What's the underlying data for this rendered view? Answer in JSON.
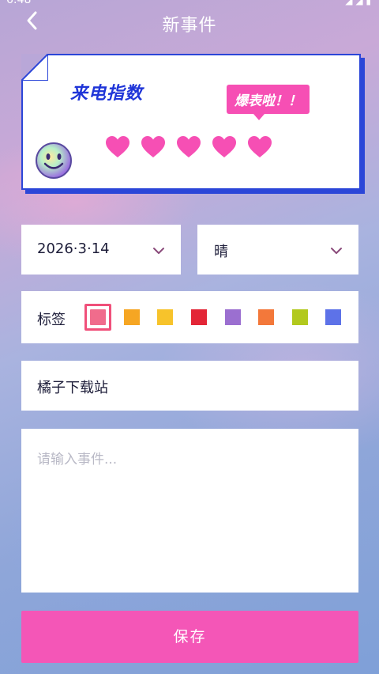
{
  "status_bar": {
    "time": "6:48",
    "icons": "◢ ◢ ▮"
  },
  "header": {
    "title": "新事件",
    "back_icon": "chevron-left-icon"
  },
  "card": {
    "title": "来电指数",
    "badge": "爆表啦！！",
    "hearts_filled": 5,
    "hearts_total": 5,
    "heart_color": "#f64fb4",
    "accent_color": "#2b46d8"
  },
  "form": {
    "date": {
      "value": "2026·3·14"
    },
    "weather": {
      "value": "晴"
    },
    "tags": {
      "label": "标签",
      "selected_index": 0,
      "colors": [
        "#f06c8c",
        "#f6a623",
        "#f7c32b",
        "#e32637",
        "#9b6fd0",
        "#f3783a",
        "#b2c91e",
        "#5d72e8"
      ]
    },
    "name": {
      "value": "橘子下载站"
    },
    "content": {
      "placeholder": "请输入事件..."
    }
  },
  "actions": {
    "save_label": "保存",
    "save_color": "#f456b7"
  }
}
